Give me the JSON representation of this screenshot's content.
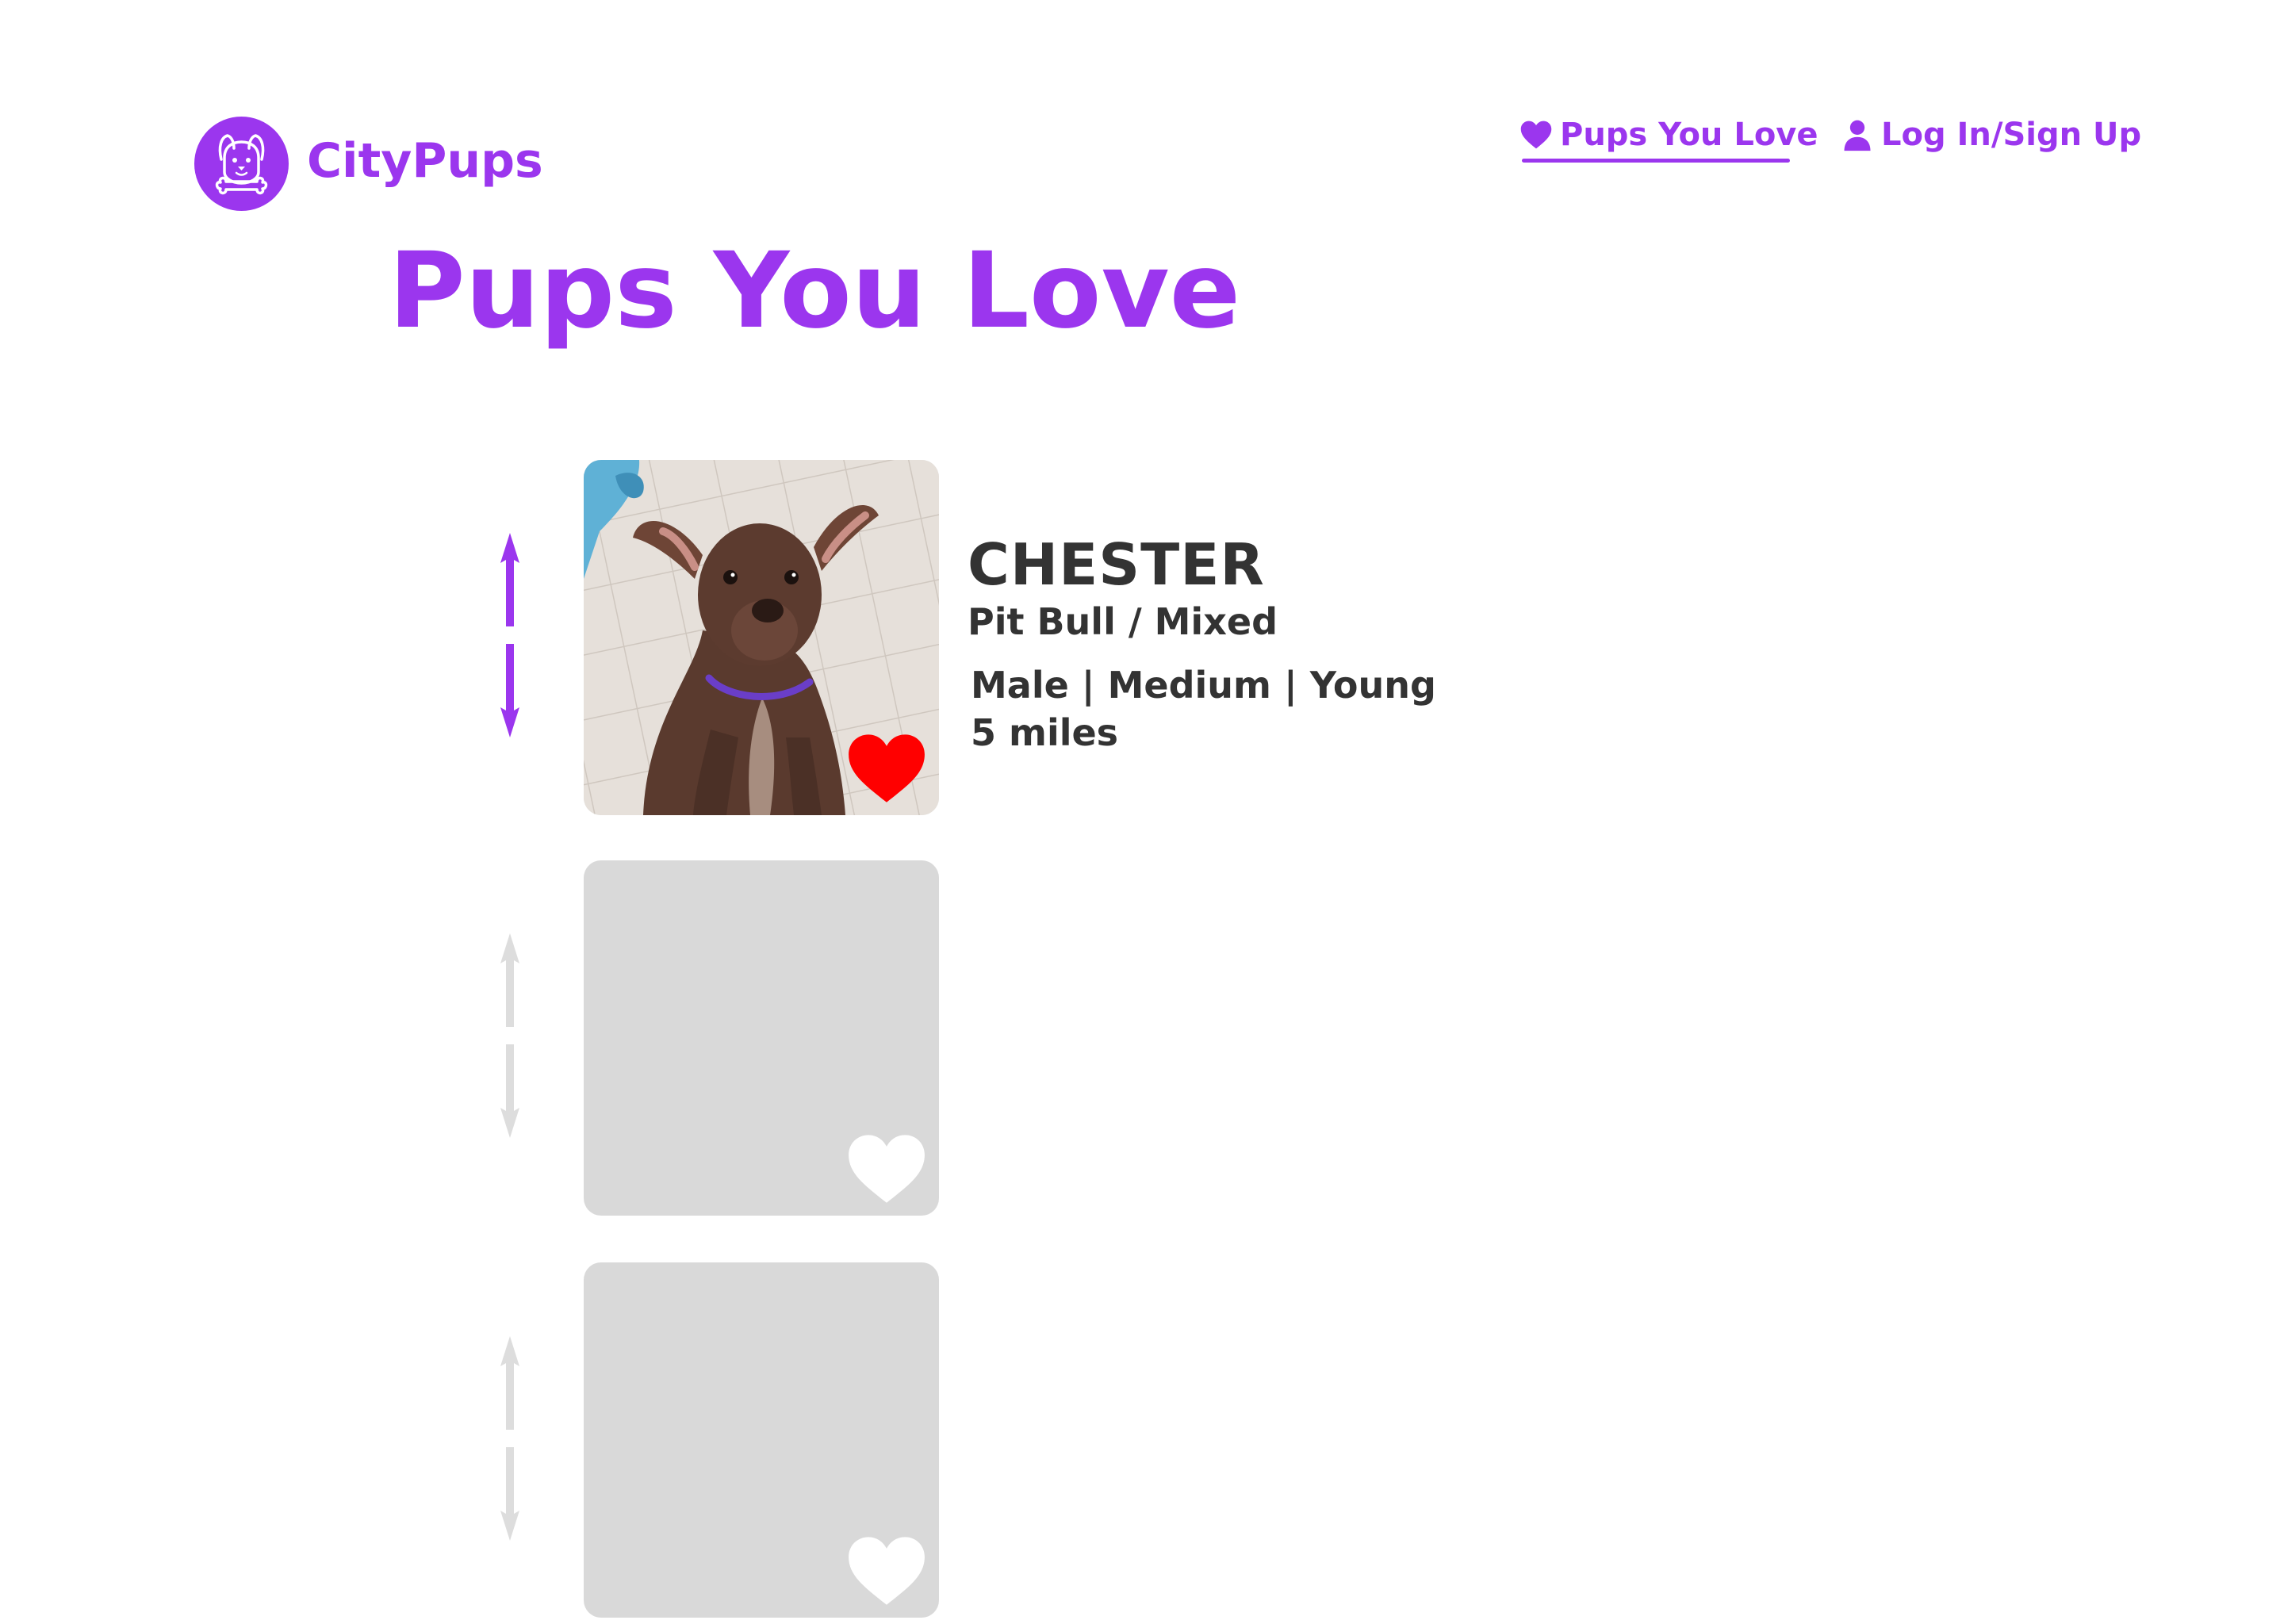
{
  "brand": {
    "name": "CityPups",
    "logo_icon": "dog-face-with-bone-icon"
  },
  "nav": {
    "pups_you_love": {
      "label": "Pups You Love",
      "icon": "heart-icon",
      "active": true
    },
    "login": {
      "label": "Log In/Sign Up",
      "icon": "user-icon"
    }
  },
  "page": {
    "title": "Pups You Love"
  },
  "favorites": [
    {
      "name": "CHESTER",
      "breed": "Pit Bull / Mixed",
      "traits": "Male | Medium | Young",
      "distance": "5 miles",
      "photo": "brown pit bull puppy with purple collar sitting on tile floor",
      "favorited": true
    },
    {
      "placeholder": true,
      "favorited": false
    },
    {
      "placeholder": true,
      "favorited": false
    }
  ],
  "colors": {
    "accent": "#9b36ee",
    "text": "#333333",
    "placeholder": "#d9d9d9",
    "inactive_arrow": "#dddddd",
    "heart_active": "#ff0000",
    "heart_inactive": "#ffffff"
  }
}
